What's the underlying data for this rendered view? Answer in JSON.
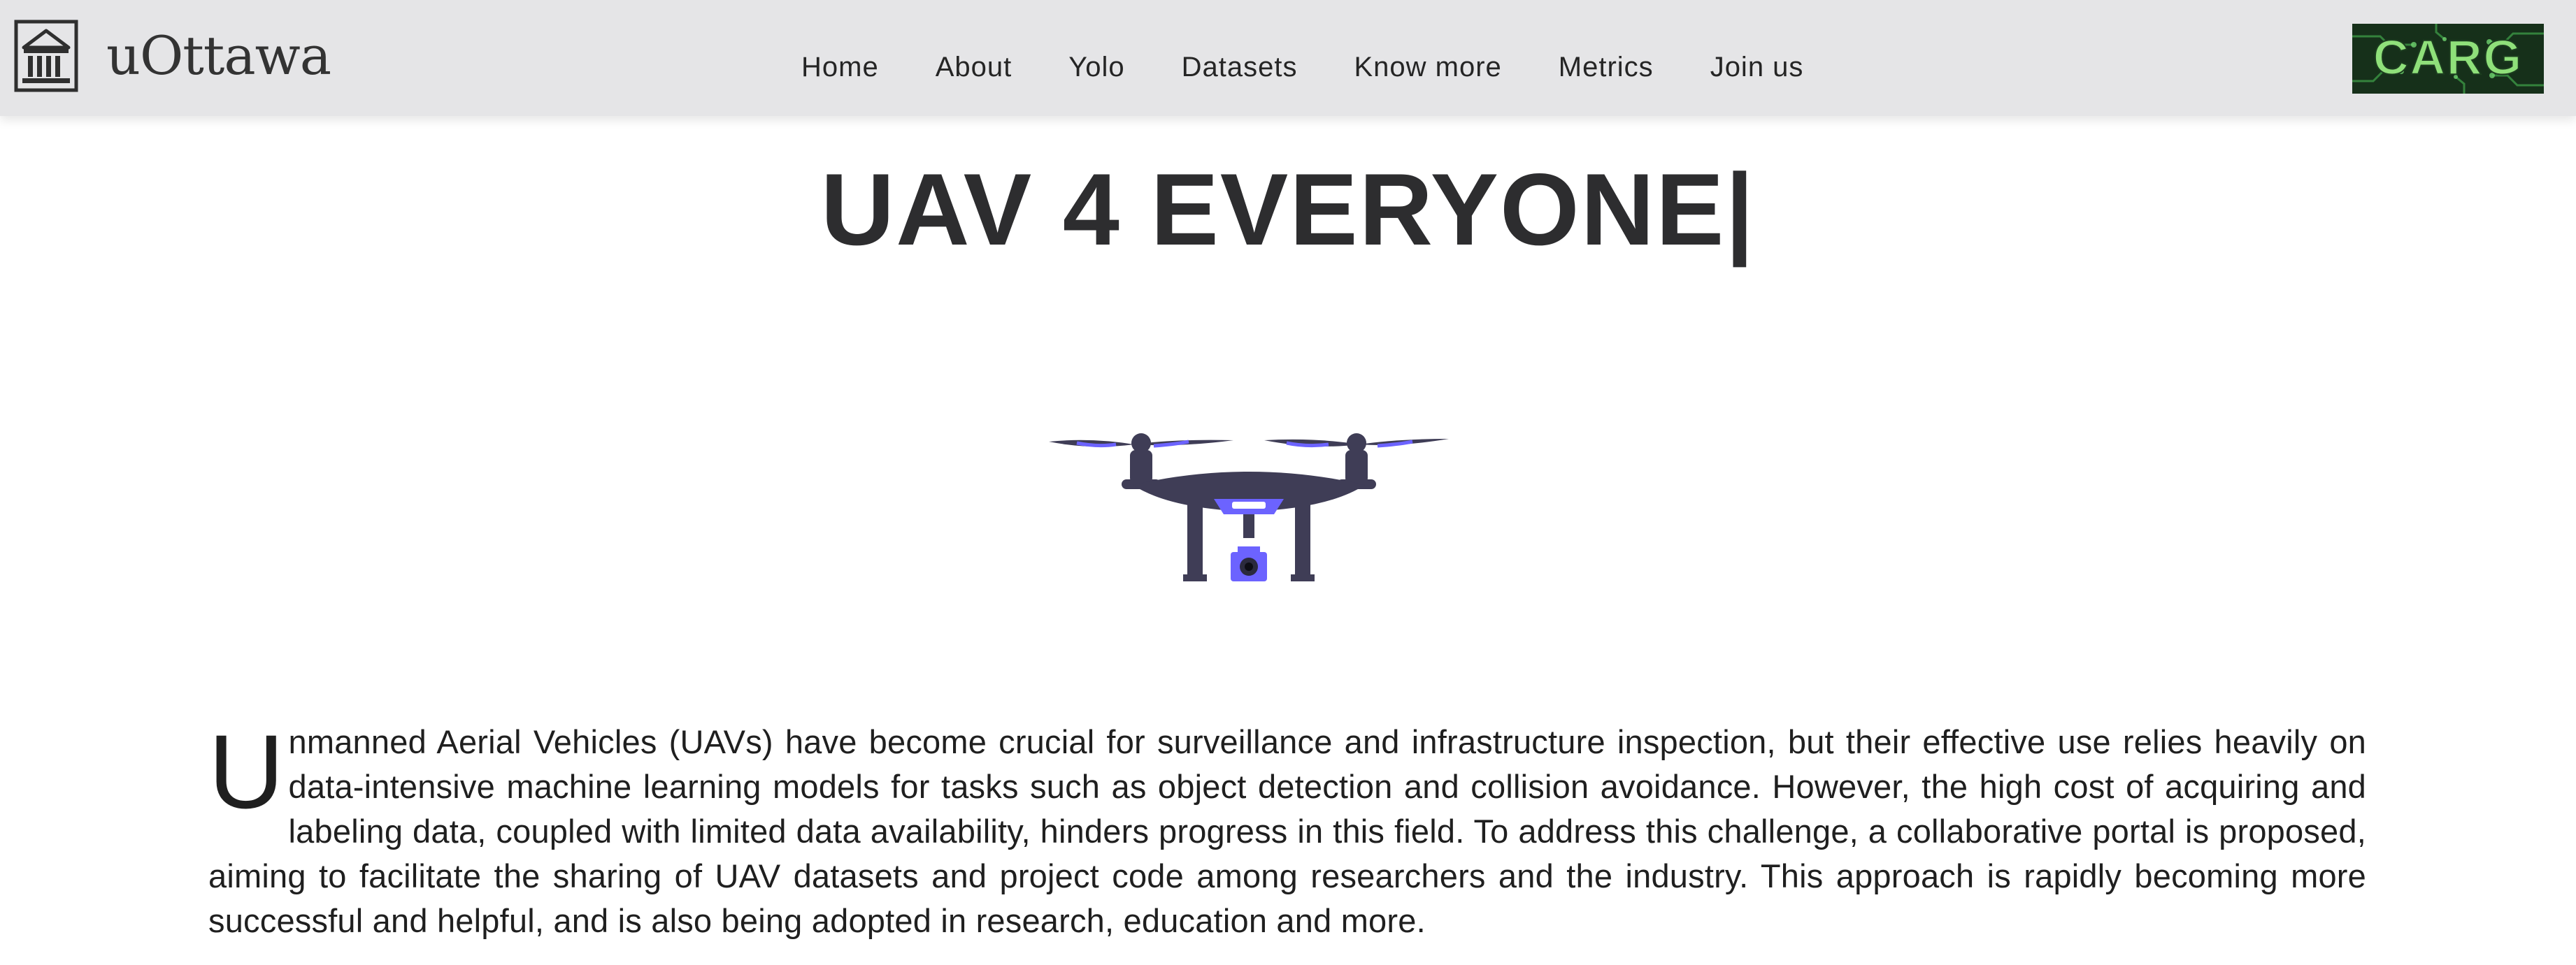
{
  "brand": {
    "name": "uOttawa",
    "icon": "university-building-icon"
  },
  "nav": {
    "links": [
      {
        "label": "Home"
      },
      {
        "label": "About"
      },
      {
        "label": "Yolo"
      },
      {
        "label": "Datasets"
      },
      {
        "label": "Know more"
      },
      {
        "label": "Metrics"
      },
      {
        "label": "Join us"
      }
    ]
  },
  "partner_logo": {
    "text": "CARG",
    "icon": "circuit-board-logo"
  },
  "hero": {
    "title": "UAV 4 EVERYONE|",
    "illustration": "drone-illustration"
  },
  "intro": {
    "dropcap": "U",
    "text": "nmanned Aerial Vehicles (UAVs) have become crucial for surveillance and infrastructure inspection, but their effective use relies heavily on data-intensive machine learning models for tasks such as object detection and collision avoidance. However, the high cost of acquiring and labeling data, coupled with limited data availability, hinders progress in this field. To address this challenge, a collaborative portal is proposed, aiming to facilitate the sharing of UAV datasets and project code among researchers and the industry. This approach is rapidly becoming more successful and helpful, and is also being adopted in research, education and more."
  },
  "colors": {
    "navbar_bg": "#e5e5e7",
    "text_dark": "#2d2d2f",
    "drone_body": "#3f3d56",
    "drone_accent": "#6c63ff",
    "logo_green": "#39b54a"
  }
}
